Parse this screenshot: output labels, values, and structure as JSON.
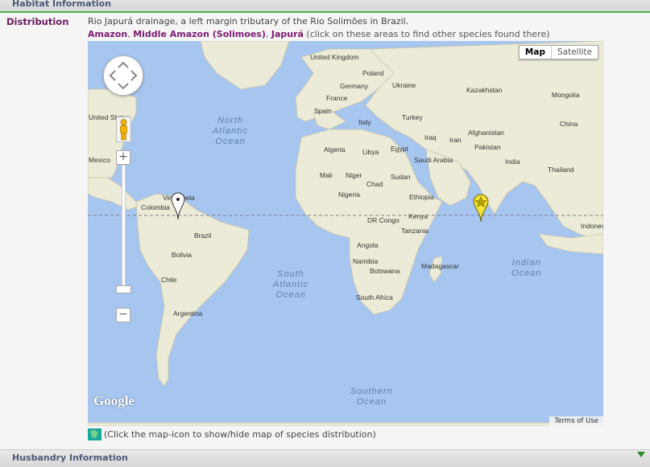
{
  "header_top": {
    "title": "Habitat Information"
  },
  "distribution": {
    "label": "Distribution",
    "description": "Rio Japurá drainage, a left margin tributary of the Rio Solimões in Brazil.",
    "areas": [
      "Amazon",
      "Middle Amazon (Solimoes)",
      "Japurá"
    ],
    "sep1": ", ",
    "sep2": ", ",
    "areas_hint": " (click on these areas to find other species found there)"
  },
  "map": {
    "type_buttons": {
      "map": "Map",
      "satellite": "Satellite"
    },
    "zoom_in": "+",
    "zoom_out": "−",
    "logo": "Google",
    "terms": "Terms of Use",
    "labels": [
      "United Kingdom",
      "Poland",
      "Germany",
      "Ukraine",
      "France",
      "Kazakhstan",
      "Mongolia",
      "Italy",
      "Spain",
      "Turkey",
      "China",
      "Afghanistan",
      "Iraq",
      "Iran",
      "Pakistan",
      "Algeria",
      "Libya",
      "Egypt",
      "Saudi Arabia",
      "India",
      "Thailand",
      "Mali",
      "Niger",
      "Sudan",
      "Chad",
      "Nigeria",
      "Ethiopia",
      "Kenya",
      "DR Congo",
      "Tanzania",
      "Angola",
      "Madagascar",
      "Namibia",
      "Botswana",
      "South Africa",
      "Colombia",
      "Venezuela",
      "Brazil",
      "Bolivia",
      "Chile",
      "Argentina",
      "Mexico",
      "United States",
      "Indonesia"
    ],
    "oceans": {
      "north_atlantic": [
        "North",
        "Atlantic",
        "Ocean"
      ],
      "south_atlantic": [
        "South",
        "Atlantic",
        "Ocean"
      ],
      "indian": [
        "Indian",
        "Ocean"
      ],
      "southern": [
        "Southern",
        "Ocean"
      ]
    },
    "marker_icons": [
      "pin-marker-icon",
      "star-marker-icon"
    ]
  },
  "map_legend": {
    "text": "(Click the map-icon to show/hide map of species distribution)"
  },
  "header_bottom": {
    "title": "Husbandry Information"
  },
  "colors": {
    "accent_green": "#4caf50",
    "area_link": "#7b1a6f",
    "ocean": "#a6c6f0",
    "land": "#ecebd8"
  }
}
